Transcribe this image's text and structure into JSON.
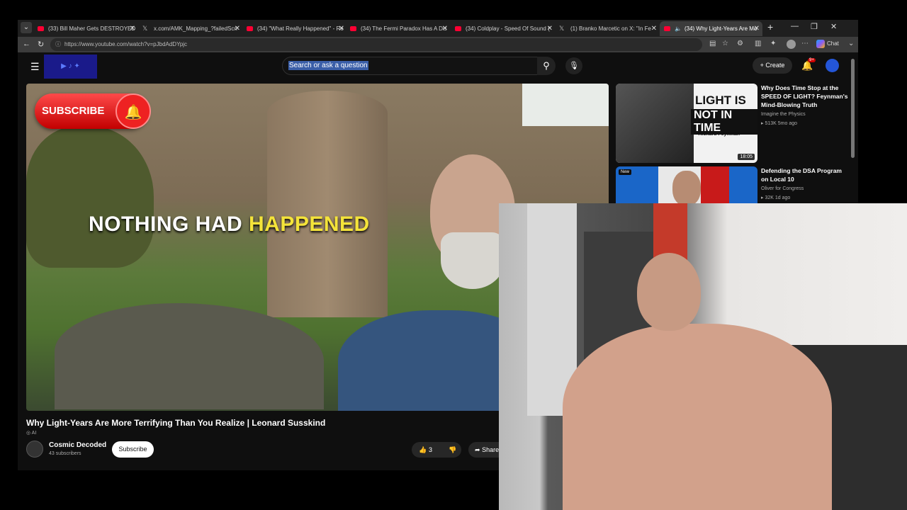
{
  "browser": {
    "tabs": [
      {
        "title": "(33) Bill Maher Gets DESTROYED",
        "favicon": "youtube",
        "active": false
      },
      {
        "title": "x.com/AMK_Mapping_?failedScri",
        "favicon": "x",
        "active": false
      },
      {
        "title": "(34) \"What Really Happened\" - Re",
        "favicon": "youtube",
        "active": false
      },
      {
        "title": "(34) The Fermi Paradox Has A Dis",
        "favicon": "youtube",
        "active": false
      },
      {
        "title": "(34) Coldplay - Speed Of Sound (",
        "favicon": "youtube",
        "active": false
      },
      {
        "title": "(1) Branko Marcetic on X: \"In Fe",
        "favicon": "x",
        "active": false
      },
      {
        "title": "(34) Why Light-Years Are Mo",
        "favicon": "youtube",
        "active": true
      }
    ],
    "url": "https://www.youtube.com/watch?v=pJbdAdDYpjc",
    "chat_label": "Chat"
  },
  "youtube": {
    "search_placeholder": "Search or ask a question",
    "create_label": "Create",
    "notification_count": "9+",
    "video": {
      "caption_white": "NOTHING HAD",
      "caption_highlight": "HAPPENED",
      "subscribe_overlay": "SUBSCRIBE",
      "title": "Why Light-Years Are More Terrifying Than You Realize | Leonard Susskind",
      "ai_label": "AI",
      "channel": "Cosmic Decoded",
      "subscribers": "43 subscribers",
      "subscribe_button": "Subscribe",
      "likes": "3",
      "share_label": "Share"
    },
    "recommendations": [
      {
        "title": "Why Does Time Stop at the SPEED OF LIGHT? Feynman's Mind-Blowing Truth",
        "channel": "Imagine the Physics",
        "meta": "513K  5mo ago",
        "duration": "18:05",
        "thumb_line1": "LIGHT IS",
        "thumb_line2": "NOT IN TIME",
        "thumb_line3": "-Richard Feynman"
      },
      {
        "title": "Defending the DSA Program on Local 10",
        "channel": "Oliver for Congress",
        "meta": "32K  1d ago",
        "badge": "New"
      }
    ]
  },
  "colors": {
    "youtube_red": "#ff0033",
    "caption_highlight": "#f4e33a",
    "page_bg": "#0f0f0f"
  }
}
